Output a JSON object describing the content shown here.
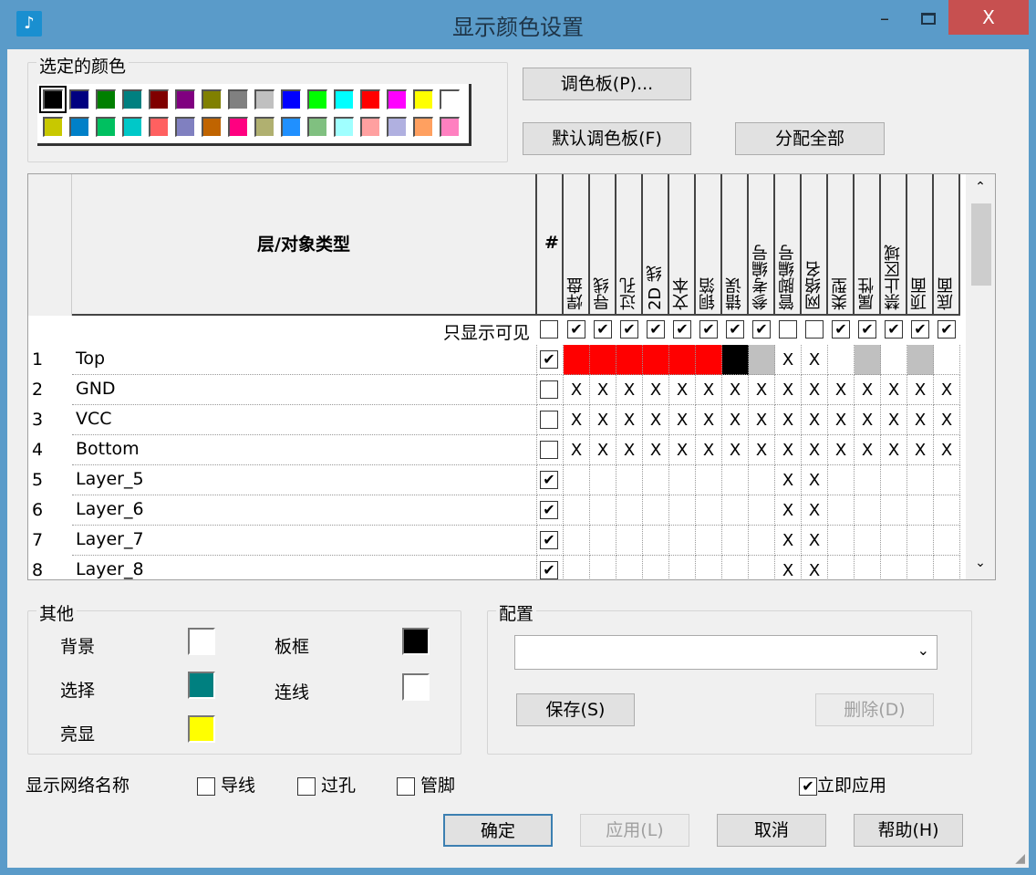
{
  "window": {
    "title": "显示颜色设置",
    "minimize": "–",
    "close": "X",
    "icon": "app-icon"
  },
  "palette": {
    "label": "选定的颜色",
    "selected_index": 0,
    "colors": [
      "#000000",
      "#000080",
      "#008000",
      "#008080",
      "#800000",
      "#800080",
      "#808000",
      "#808080",
      "#c0c0c0",
      "#0000ff",
      "#00ff00",
      "#00ffff",
      "#ff0000",
      "#ff00ff",
      "#ffff00",
      "#ffffff",
      "#c8c800",
      "#0080c8",
      "#00c060",
      "#00c8c8",
      "#ff6060",
      "#8080c0",
      "#c06400",
      "#ff0080",
      "#b0b070",
      "#2090ff",
      "#80c080",
      "#a0ffff",
      "#ffa0a0",
      "#b0b0e0",
      "#ffa060",
      "#ff80c0"
    ]
  },
  "buttons": {
    "palette": "调色板(P)...",
    "default_palette": "默认调色板(F)",
    "assign_all": "分配全部"
  },
  "grid": {
    "header_title": "层/对象类型",
    "hash": "#",
    "visible_only_label": "只显示可见",
    "columns": [
      "焊盘",
      "导线",
      "过孔",
      "2D 线",
      "文本",
      "铜箔",
      "错误",
      "参考编号",
      "管脚编号",
      "网络名",
      "类型",
      "属性",
      "禁止区域",
      "顶面",
      "底面"
    ],
    "visible_only_checks": [
      true,
      true,
      true,
      true,
      true,
      true,
      true,
      true,
      false,
      false,
      true,
      true,
      true,
      true,
      true
    ],
    "visible_only_hash": false,
    "rows": [
      {
        "num": "1",
        "name": "Top",
        "checked": true,
        "cells": [
          "#ff0000",
          "#ff0000",
          "#ff0000",
          "#ff0000",
          "#ff0000",
          "#ff0000",
          "#000000",
          "#c0c0c0",
          "X",
          "X",
          "#ffffff",
          "#c0c0c0",
          "#ffffff",
          "#c0c0c0",
          "#ffffff"
        ]
      },
      {
        "num": "2",
        "name": "GND",
        "checked": false,
        "cells": [
          "X",
          "X",
          "X",
          "X",
          "X",
          "X",
          "X",
          "X",
          "X",
          "X",
          "X",
          "X",
          "X",
          "X",
          "X"
        ]
      },
      {
        "num": "3",
        "name": "VCC",
        "checked": false,
        "cells": [
          "X",
          "X",
          "X",
          "X",
          "X",
          "X",
          "X",
          "X",
          "X",
          "X",
          "X",
          "X",
          "X",
          "X",
          "X"
        ]
      },
      {
        "num": "4",
        "name": "Bottom",
        "checked": false,
        "cells": [
          "X",
          "X",
          "X",
          "X",
          "X",
          "X",
          "X",
          "X",
          "X",
          "X",
          "X",
          "X",
          "X",
          "X",
          "X"
        ]
      },
      {
        "num": "5",
        "name": "Layer_5",
        "checked": true,
        "cells": [
          "",
          "",
          "",
          "",
          "",
          "",
          "",
          "",
          "X",
          "X",
          "",
          "",
          "",
          "",
          ""
        ]
      },
      {
        "num": "6",
        "name": "Layer_6",
        "checked": true,
        "cells": [
          "",
          "",
          "",
          "",
          "",
          "",
          "",
          "",
          "X",
          "X",
          "",
          "",
          "",
          "",
          ""
        ]
      },
      {
        "num": "7",
        "name": "Layer_7",
        "checked": true,
        "cells": [
          "",
          "",
          "",
          "",
          "",
          "",
          "",
          "",
          "X",
          "X",
          "",
          "",
          "",
          "",
          ""
        ]
      },
      {
        "num": "8",
        "name": "Layer_8",
        "checked": true,
        "cells": [
          "",
          "",
          "",
          "",
          "",
          "",
          "",
          "",
          "X",
          "X",
          "",
          "",
          "",
          "",
          ""
        ]
      }
    ]
  },
  "other": {
    "label": "其他",
    "background": "背景",
    "background_color": "#ffffff",
    "board": "板框",
    "board_color": "#000000",
    "selection": "选择",
    "selection_color": "#008080",
    "connection": "连线",
    "connection_color": "#ffffff",
    "highlight": "亮显",
    "highlight_color": "#ffff00"
  },
  "config": {
    "label": "配置",
    "value": "",
    "save": "保存(S)",
    "delete": "删除(D)"
  },
  "netnames": {
    "label": "显示网络名称",
    "trace": "导线",
    "via": "过孔",
    "pin": "管脚",
    "trace_checked": false,
    "via_checked": false,
    "pin_checked": false
  },
  "apply_now": {
    "label": "立即应用",
    "checked": true
  },
  "footer": {
    "ok": "确定",
    "apply": "应用(L)",
    "cancel": "取消",
    "help": "帮助(H)"
  },
  "check_glyph": "✔"
}
